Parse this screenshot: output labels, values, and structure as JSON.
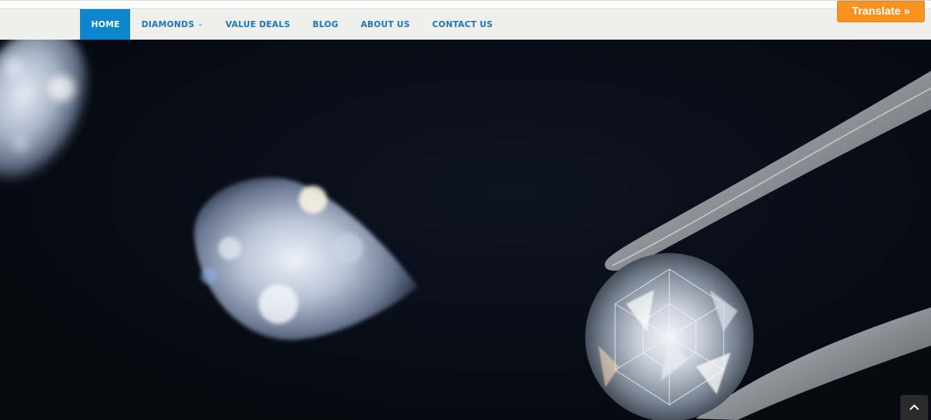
{
  "nav": {
    "items": [
      {
        "label": "HOME",
        "active": true
      },
      {
        "label": "DIAMONDS",
        "dropdown": true
      },
      {
        "label": "VALUE DEALS"
      },
      {
        "label": "BLOG"
      },
      {
        "label": "ABOUT US"
      },
      {
        "label": "CONTACT US"
      }
    ]
  },
  "translate": {
    "label": "Translate »"
  },
  "hero": {
    "image": "diamonds-with-tweezers-photo"
  },
  "colors": {
    "nav_active_bg": "#0b86cf",
    "nav_text": "#1f78bd",
    "translate_bg": "#f7931e",
    "navbar_bg": "#efefeb"
  },
  "icons": {
    "dropdown": "chevron-down-icon",
    "scroll_top": "chevron-up-icon"
  }
}
